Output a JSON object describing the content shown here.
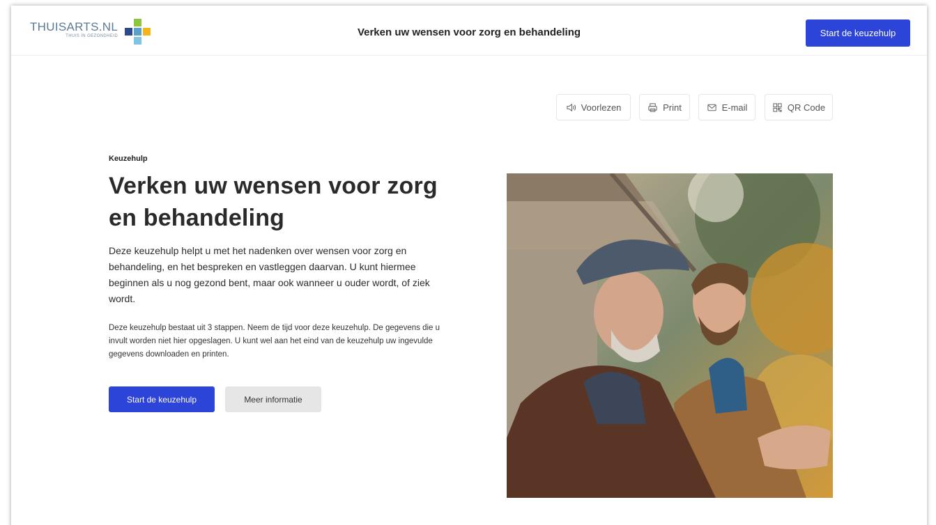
{
  "header": {
    "logo_name": "THUISARTS.NL",
    "logo_tagline": "THUIS IN GEZONDHEID",
    "title": "Verken uw wensen voor zorg en behandeling",
    "cta_label": "Start de keuzehulp"
  },
  "utilities": [
    {
      "label": "Voorlezen",
      "icon": "speaker-icon"
    },
    {
      "label": "Print",
      "icon": "printer-icon"
    },
    {
      "label": "E-mail",
      "icon": "mail-icon"
    },
    {
      "label": "QR Code",
      "icon": "qr-code-icon"
    }
  ],
  "main": {
    "eyebrow": "Keuzehulp",
    "title": "Verken uw wensen voor zorg en behandeling",
    "lead": "Deze keuzehulp helpt u met het nadenken over wensen voor zorg en behandeling, en het bespreken en vastleggen daarvan. U kunt hiermee beginnen als u nog gezond bent, maar ook wanneer u ouder wordt, of ziek wordt.",
    "body": "Deze keuzehulp bestaat uit 3 stappen. Neem de tijd voor deze keuzehulp. De gegevens die u invult worden niet hier opgeslagen. U kunt wel aan het eind van de keuzehulp uw ingevulde gegevens downloaden en printen.",
    "primary_button": "Start de keuzehulp",
    "secondary_button": "Meer informatie"
  },
  "colors": {
    "accent": "#2d44d8",
    "logo_green": "#8dc63f",
    "logo_yellow": "#f4b41a",
    "logo_blue": "#2b4a8c",
    "logo_lightblue": "#7fc4e0"
  }
}
